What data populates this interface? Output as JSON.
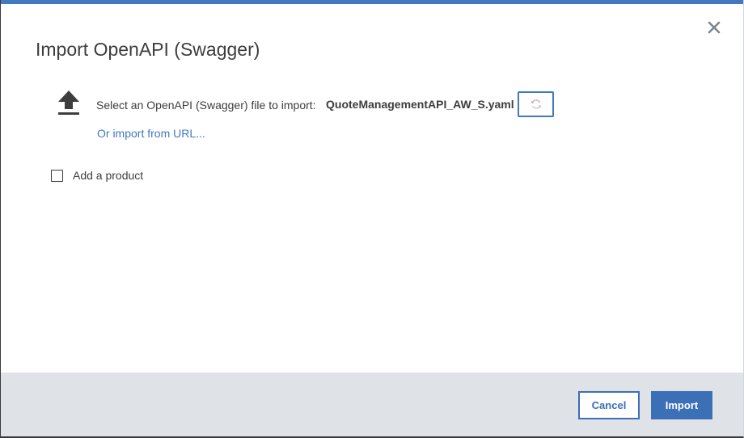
{
  "dialog": {
    "title": "Import OpenAPI (Swagger)",
    "accent_color": "#4178be",
    "footer_color": "#dfe3e8"
  },
  "file_select": {
    "label": "Select an OpenAPI (Swagger) file to import:",
    "file_name": "QuoteManagementAPI_AW_S.yaml",
    "icon": "upload-icon",
    "refresh_icon": "refresh-icon"
  },
  "url_import": {
    "link_text": "Or import from URL..."
  },
  "product": {
    "label": "Add a product",
    "checked": false
  },
  "footer": {
    "cancel_label": "Cancel",
    "import_label": "Import"
  }
}
